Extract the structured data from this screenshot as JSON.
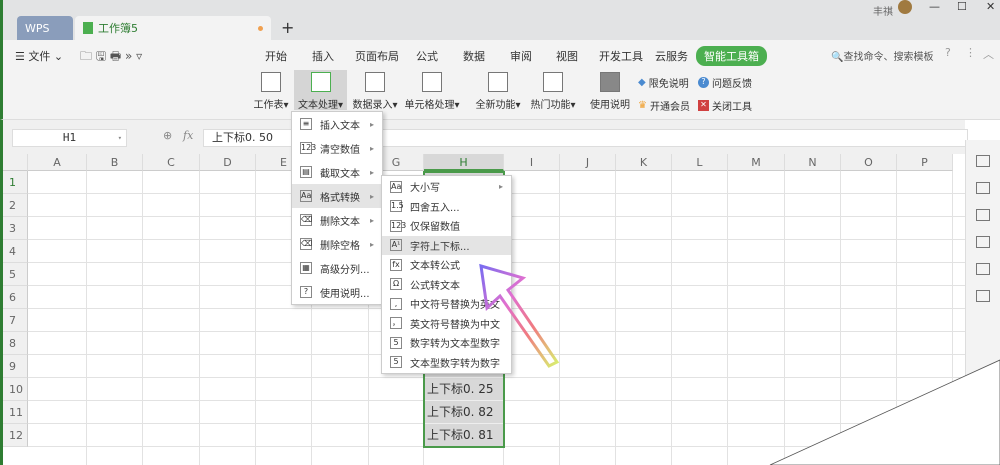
{
  "titlebar": {
    "wps_tab": "WPS",
    "doc_tab": "工作簿5",
    "new_tab": "+",
    "user": "丰祺",
    "minimize": "—",
    "maximize": "☐",
    "close": "✕"
  },
  "quickbar": {
    "file": "文件",
    "more": "»"
  },
  "ribbon_tabs": [
    "开始",
    "插入",
    "页面布局",
    "公式",
    "数据",
    "审阅",
    "视图",
    "开发工具",
    "云服务",
    "智能工具箱"
  ],
  "search": "查找命令、搜索模板",
  "ribbon_buttons": [
    "工作表",
    "文本处理",
    "数据录入",
    "单元格处理",
    "全新功能",
    "热门功能",
    "使用说明"
  ],
  "ribbon_small": [
    "限免说明",
    "问题反馈",
    "开通会员",
    "关闭工具"
  ],
  "formula": {
    "name_box": "H1",
    "fx": "fx",
    "value": "上下标0. 50"
  },
  "columns": [
    "A",
    "B",
    "C",
    "D",
    "E",
    "F",
    "G",
    "H",
    "I",
    "J",
    "K",
    "L",
    "M",
    "N",
    "O",
    "P"
  ],
  "rows": [
    "1",
    "2",
    "3",
    "4",
    "5",
    "6",
    "7",
    "8",
    "9",
    "10",
    "11",
    "12"
  ],
  "cells_h": {
    "10": "上下标0. 25",
    "11": "上下标0. 82",
    "12": "上下标0. 81"
  },
  "menu": [
    {
      "label": "插入文本",
      "icon": "≡",
      "sub": true
    },
    {
      "label": "清空数值",
      "icon": "123",
      "sub": true
    },
    {
      "label": "截取文本",
      "icon": "▤",
      "sub": true
    },
    {
      "label": "格式转换",
      "icon": "Aa",
      "sub": true
    },
    {
      "label": "删除文本",
      "icon": "⌫",
      "sub": true
    },
    {
      "label": "删除空格",
      "icon": "⌫",
      "sub": true
    },
    {
      "label": "高级分列...",
      "icon": "▦",
      "sub": false
    },
    {
      "label": "使用说明...",
      "icon": "?",
      "sub": false
    }
  ],
  "submenu": [
    {
      "label": "大小写",
      "icon": "Aa",
      "sub": true
    },
    {
      "label": "四舍五入...",
      "icon": "1.5"
    },
    {
      "label": "仅保留数值",
      "icon": "123"
    },
    {
      "label": "字符上下标...",
      "icon": "A¹"
    },
    {
      "label": "文本转公式",
      "icon": "fx"
    },
    {
      "label": "公式转文本",
      "icon": "Ω"
    },
    {
      "label": "中文符号替换为英文",
      "icon": ","
    },
    {
      "label": "英文符号替换为中文",
      "icon": "，"
    },
    {
      "label": "数字转为文本型数字",
      "icon": "5"
    },
    {
      "label": "文本型数字转为数字",
      "icon": "5"
    }
  ],
  "colors": {
    "accent": "#4caf50",
    "border": "#2e7d32"
  }
}
